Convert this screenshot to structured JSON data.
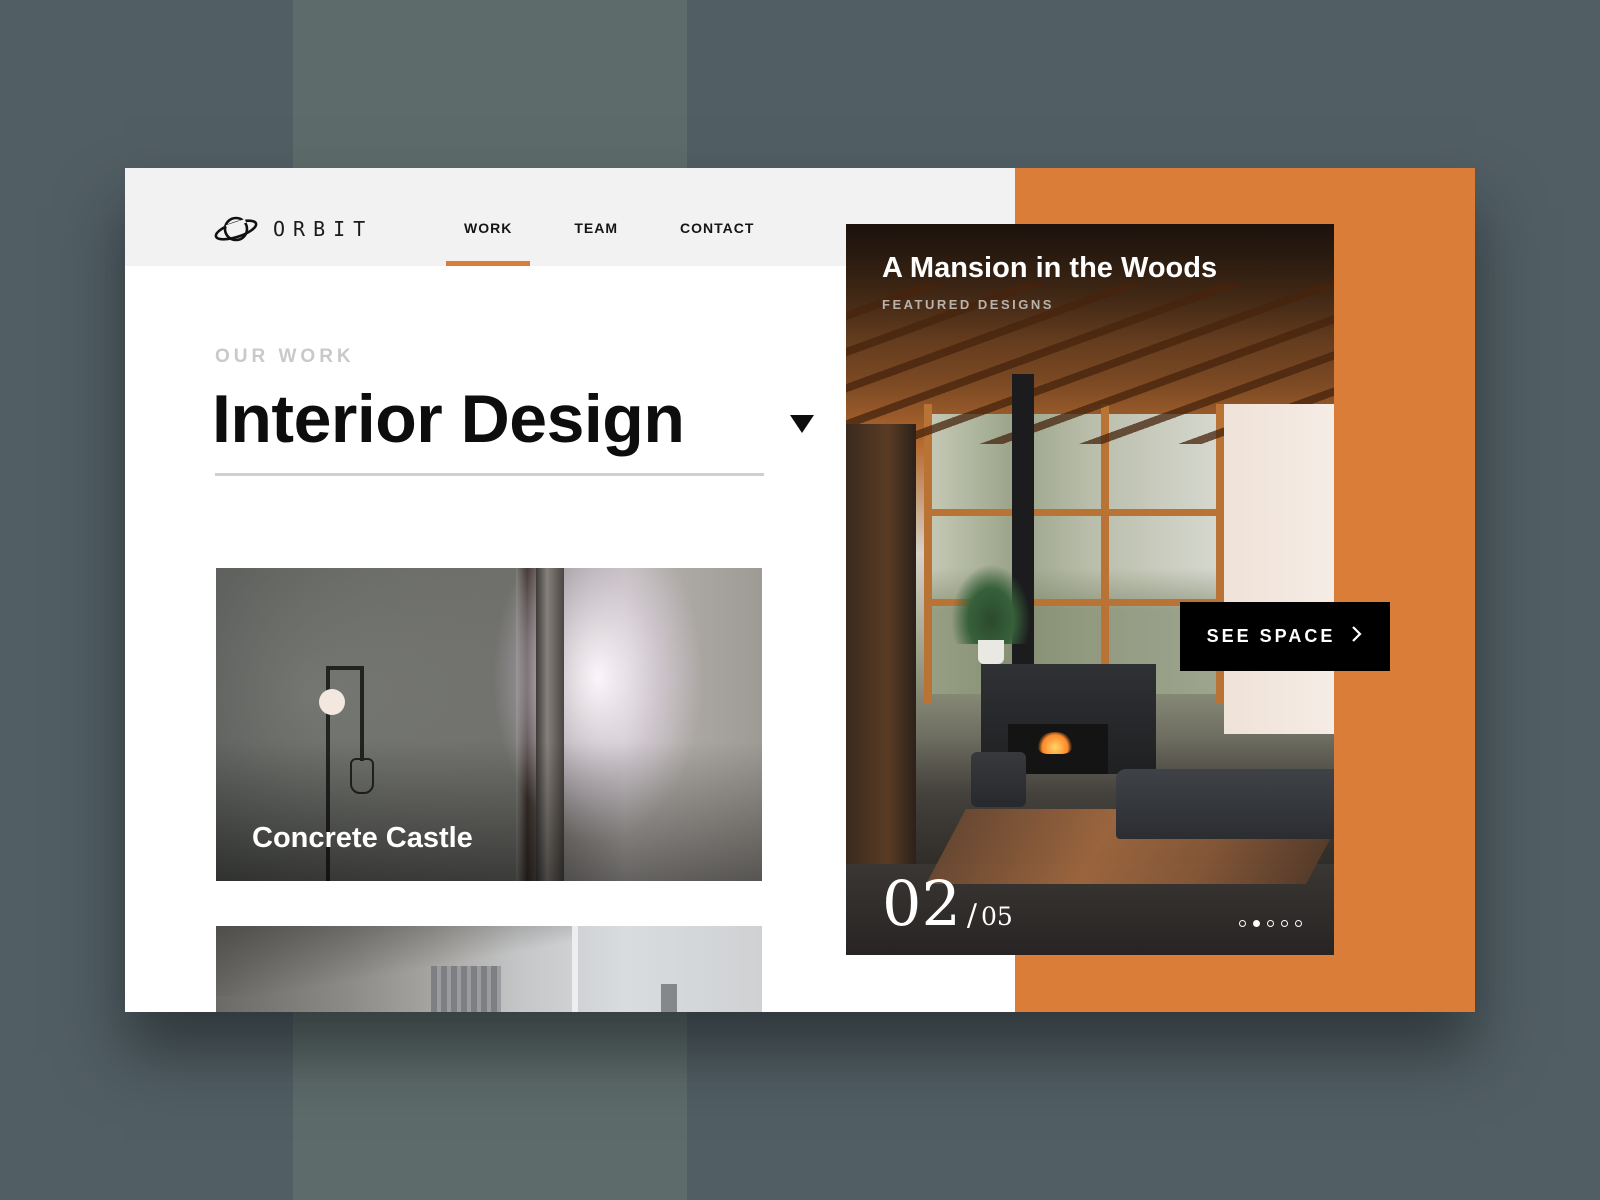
{
  "brand": {
    "name": "ORBIT",
    "logo_icon": "planet-icon"
  },
  "nav": {
    "items": [
      {
        "label": "WORK",
        "active": true
      },
      {
        "label": "TEAM",
        "active": false
      },
      {
        "label": "CONTACT",
        "active": false
      }
    ]
  },
  "hero": {
    "eyebrow": "OUR WORK",
    "title": "Interior Design",
    "dropdown_icon": "caret-down-icon"
  },
  "cards": [
    {
      "title": "Concrete Castle"
    },
    {
      "title": ""
    }
  ],
  "featured": {
    "title": "A Mansion in the Woods",
    "subtitle": "FEATURED DESIGNS",
    "current": "02",
    "separator": "/",
    "total": "05",
    "slide_count": 5,
    "active_slide": 2,
    "cta_label": "SEE SPACE",
    "cta_icon": "chevron-right-icon"
  },
  "colors": {
    "accent": "#d97d38",
    "background": "#515e64",
    "topbar": "#f2f2f2",
    "text": "#0d0d0d"
  }
}
